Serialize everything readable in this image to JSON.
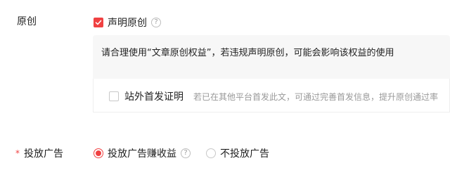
{
  "original": {
    "label": "原创",
    "declare_label": "声明原创",
    "declare_checked": true,
    "help_icon": "question-circle-icon",
    "info_text": "请合理使用“文章原创权益”，若违规声明原创，可能会影响该权益的使用",
    "first_publish_label": "站外首发证明",
    "first_publish_checked": false,
    "first_publish_hint": "若已在其他平台首发此文，可通过完善首发信息，提升原创通过率"
  },
  "ads": {
    "required_mark": "*",
    "label": "投放广告",
    "options": [
      {
        "label": "投放广告赚收益",
        "selected": true,
        "has_help": true
      },
      {
        "label": "不投放广告",
        "selected": false,
        "has_help": false
      }
    ]
  },
  "colors": {
    "accent": "#f04142",
    "panel_bg": "#f7f7f7",
    "hint": "#999999"
  }
}
